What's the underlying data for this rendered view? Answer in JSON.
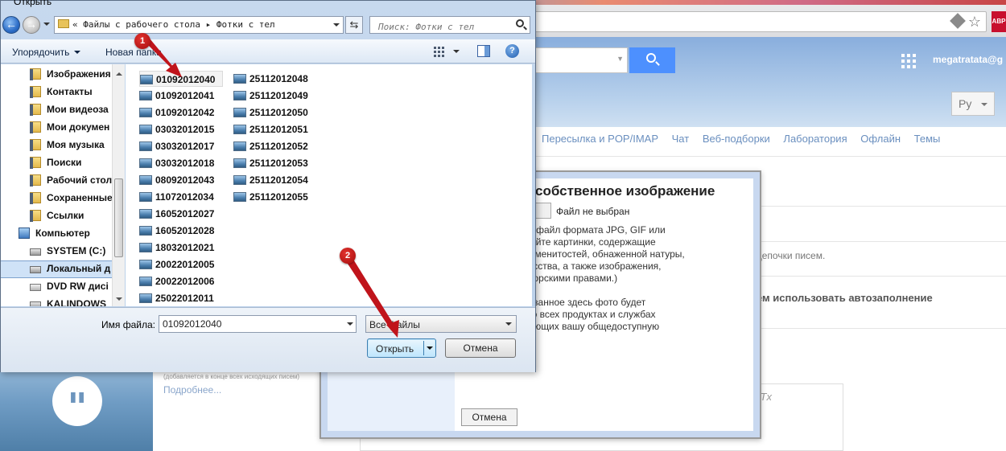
{
  "browser": {
    "abp_label": "ABP",
    "user": "megatratata@g",
    "lang": "Ру",
    "nav_tabs": [
      "Пересылка и POP/IMAP",
      "Чат",
      "Веб-подборки",
      "Лаборатория",
      "Офлайн",
      "Темы"
    ],
    "settings_text_1": "цепочки писем.",
    "settings_text_2": "ем использовать автозаполнение",
    "signature_note": "(добавляется в конце всех исходящих писем)",
    "more_link": "Подробнее...",
    "editor_tx": "Tx"
  },
  "modal": {
    "title": "собственное изображение",
    "file_button": "ил",
    "file_status": "Файл не выбран",
    "desc_lines": "ть файл формата JPG, GIF или\nжайте картинки, содержащие\nраменитостей, обнаженной натуры,\nкусства, а также изображения,\nвторскими правами.)",
    "desc_lines_2": "казанное здесь фото будет\n во всех продуктах и службах\nкающих вашу общедоступную",
    "cancel": "Отмена"
  },
  "dialog": {
    "title": "Открыть",
    "breadcrumb": [
      "«",
      "Файлы с рабочего стола",
      "▸",
      "Фотки с тел"
    ],
    "search_placeholder": "Поиск: Фотки с тел",
    "organize": "Упорядочить",
    "new_folder": "Новая папка",
    "help": "?",
    "tree": [
      {
        "label": "Изображения",
        "icon": "folder"
      },
      {
        "label": "Контакты",
        "icon": "folder"
      },
      {
        "label": "Мои видеоза",
        "icon": "folder"
      },
      {
        "label": "Мои докумен",
        "icon": "folder"
      },
      {
        "label": "Моя музыка",
        "icon": "folder"
      },
      {
        "label": "Поиски",
        "icon": "folder"
      },
      {
        "label": "Рабочий стол",
        "icon": "folder"
      },
      {
        "label": "Сохраненные",
        "icon": "folder"
      },
      {
        "label": "Ссылки",
        "icon": "folder"
      },
      {
        "label": "Компьютер",
        "icon": "pc"
      },
      {
        "label": "SYSTEM (C:)",
        "icon": "drive"
      },
      {
        "label": "Локальный д",
        "icon": "drive"
      },
      {
        "label": "DVD RW дисі",
        "icon": "dvd"
      },
      {
        "label": "KALINDOWS",
        "icon": "drive"
      }
    ],
    "files_col1": [
      "01092012040",
      "01092012041",
      "01092012042",
      "03032012015",
      "03032012017",
      "03032012018",
      "08092012043",
      "11072012034",
      "16052012027",
      "16052012028",
      "18032012021",
      "20022012005",
      "20022012006",
      "25022012011"
    ],
    "files_col2": [
      "25112012048",
      "25112012049",
      "25112012050",
      "25112012051",
      "25112012052",
      "25112012053",
      "25112012054",
      "25112012055"
    ],
    "filename_label": "Имя файла:",
    "filename_value": "01092012040",
    "filetype": "Все файлы",
    "open": "Открыть",
    "cancel": "Отмена"
  },
  "markers": [
    "1",
    "2"
  ],
  "colors": {
    "marker": "#c0141b",
    "selection": "#cfe2f7",
    "accent": "#4d90fe"
  }
}
